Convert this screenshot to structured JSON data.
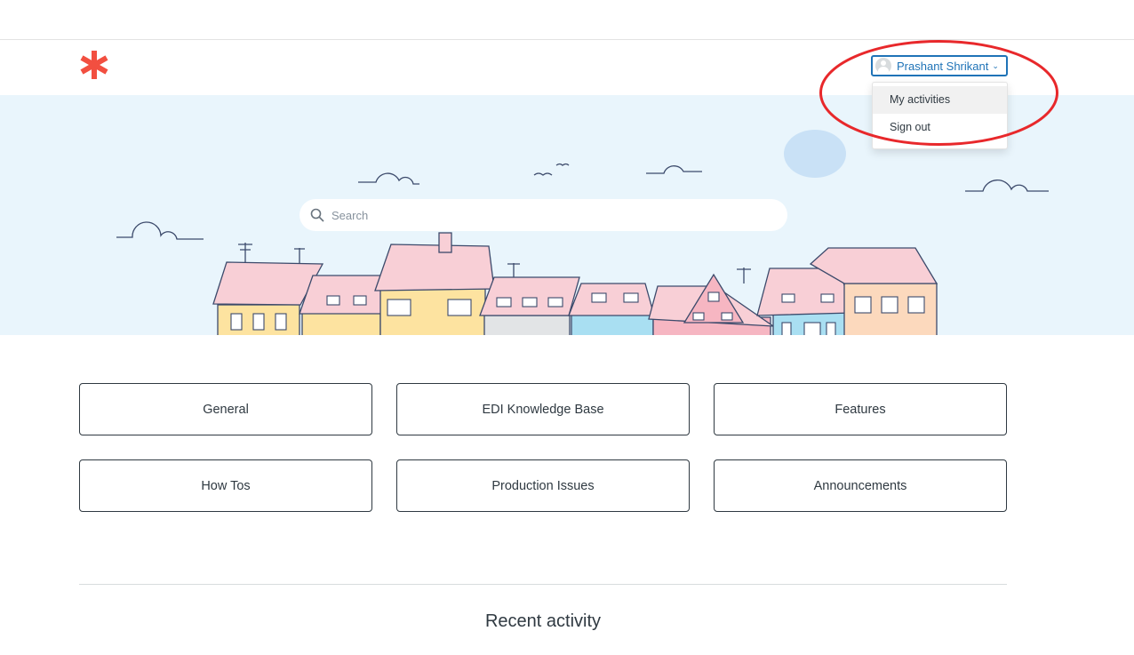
{
  "header": {
    "logo_icon": "asterisk-logo-icon",
    "brand_color": "#f24f40",
    "user": {
      "name": "Prashant Shrikant",
      "avatar_icon": "user-avatar-icon",
      "accent_color": "#1f73b7"
    },
    "user_menu": {
      "items": [
        {
          "label": "My activities"
        },
        {
          "label": "Sign out"
        }
      ]
    },
    "annotation_color": "#e8282b"
  },
  "hero": {
    "background_color": "#e9f5fc",
    "search": {
      "placeholder": "Search",
      "icon": "search-icon"
    }
  },
  "categories": [
    {
      "label": "General"
    },
    {
      "label": "EDI Knowledge Base"
    },
    {
      "label": "Features"
    },
    {
      "label": "How Tos"
    },
    {
      "label": "Production Issues"
    },
    {
      "label": "Announcements"
    }
  ],
  "recent_activity": {
    "title": "Recent activity"
  }
}
